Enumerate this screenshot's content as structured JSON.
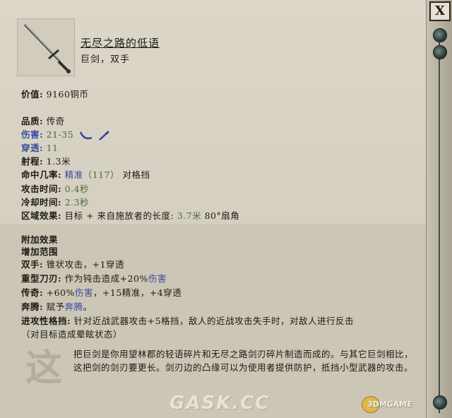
{
  "item": {
    "name": "无尽之路的低语",
    "type": "巨剑，双手"
  },
  "stats": {
    "value_label": "价值:",
    "value": "9160铜币",
    "quality_label": "品质:",
    "quality": "传奇",
    "damage_label": "伤害:",
    "damage": "21-35",
    "penetration_label": "穿透:",
    "penetration": "11",
    "range_label": "射程:",
    "range": "1.3米",
    "accuracy_label": "命中几率:",
    "accuracy_type": "精准",
    "accuracy_value": "（117）",
    "accuracy_vs": "对格挡",
    "attack_time_label": "攻击时间:",
    "attack_time": "0.4秒",
    "recovery_label": "冷却时间:",
    "recovery": "2.3秒",
    "aoe_label": "区域效果:",
    "aoe_prefix": "目标 + 来自施放者的长度:",
    "aoe_length": "3.7米",
    "aoe_angle": "80°扇角"
  },
  "effects": {
    "header": "附加效果",
    "range_up": "增加范围",
    "twohand_label": "双手:",
    "twohand_text": "锥状攻击，+1穿透",
    "heavy_label": "重型刀刃:",
    "heavy_text_a": "作为钝击造成+20%",
    "heavy_text_b": "伤害",
    "legend_label": "传奇:",
    "legend_a": "+60%",
    "legend_b": "伤害",
    "legend_c": "，+15精准，+4穿透",
    "gallop_label": "奔腾:",
    "gallop_a": "赋予",
    "gallop_b": "奔腾",
    "gallop_c": "。",
    "riposte_label": "进攻性格挡:",
    "riposte_text": "针对近战武器攻击+5格挡，敌人的近战攻击失手时，对敌人进行反击",
    "riposte_note": "（对目标造成晕眩状态）"
  },
  "flavor": "把巨剑是你用望林郡的轻语碎片和无尽之路剑刃碎片制造而成的。与其它巨剑相比，这把剑的剑刃要更长。剑刃边的凸缘可以为使用者提供防护，抵挡小型武器的攻击。",
  "seal_char": "这",
  "close_label": "X",
  "watermark": "GASK.CC",
  "watermark2": "3DMGAME",
  "icons": [
    "sword-icon",
    "slash-damage-icon",
    "pierce-damage-icon",
    "close-icon"
  ],
  "colors": {
    "keyword": "#3a4aa0",
    "value_green": "#4d6a3a",
    "parchment": "#d9d4c6"
  }
}
